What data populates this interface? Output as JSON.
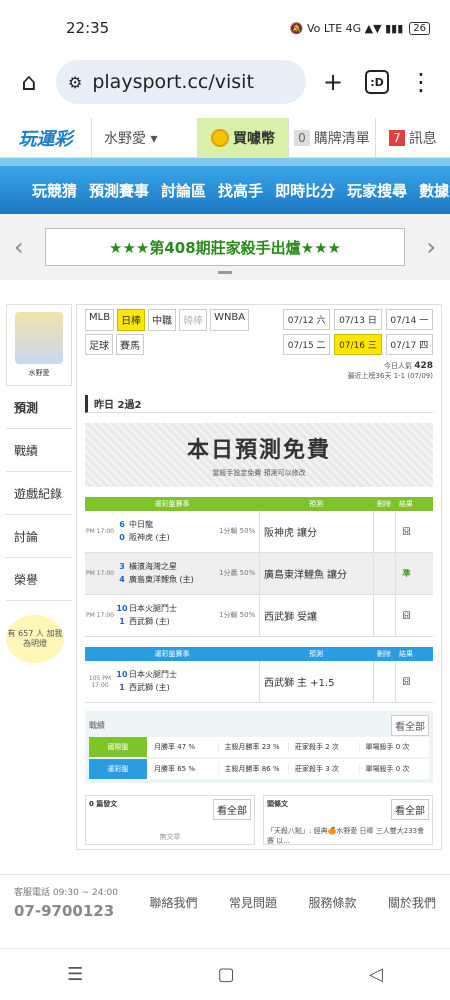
{
  "status": {
    "time": "22:35",
    "icons": "🔕 Vo LTE 4G ▲▼ ▮▮▮",
    "battery": "26"
  },
  "browser": {
    "url": "playsport.cc/visit",
    "tabs": ":D"
  },
  "topnav": {
    "logo": "玩運彩",
    "user": "水野愛 ▾",
    "buy": "買噱幣",
    "cart_count": "0",
    "cart": "購牌清單",
    "msg_count": "7",
    "msg": "訊息"
  },
  "mainnav": [
    "玩競猜",
    "預測賽事",
    "討論區",
    "找高手",
    "即時比分",
    "玩家搜尋",
    "數據"
  ],
  "banner": "★★★第408期莊家殺手出爐★★★",
  "sidebar": {
    "avatar_name": "水野愛",
    "items": [
      "預測",
      "戰績",
      "遊戲紀錄",
      "討論",
      "榮譽"
    ],
    "bulb": "有 657 人 加我為明燈"
  },
  "sports": [
    {
      "label": "MLB",
      "sel": false,
      "dis": false
    },
    {
      "label": "日棒",
      "sel": true,
      "dis": false
    },
    {
      "label": "中職",
      "sel": false,
      "dis": false
    },
    {
      "label": "韓棒",
      "sel": false,
      "dis": true
    },
    {
      "label": "WNBA",
      "sel": false,
      "dis": false
    },
    {
      "label": "足球",
      "sel": false,
      "dis": false
    },
    {
      "label": "賽馬",
      "sel": false,
      "dis": false
    }
  ],
  "dates": [
    {
      "label": "07/12 六",
      "sel": false
    },
    {
      "label": "07/13 日",
      "sel": false
    },
    {
      "label": "07/14 一",
      "sel": false
    },
    {
      "label": "07/15 二",
      "sel": false
    },
    {
      "label": "07/16 三",
      "sel": true
    },
    {
      "label": "07/17 四",
      "sel": false
    }
  ],
  "popularity": {
    "label": "今日人氣",
    "value": "428",
    "sub": "最近上榜36天 1-1 (07/09)"
  },
  "record": "昨日 2過2",
  "free": {
    "title": "本日預測免費",
    "sub": "當殺手設定免費 預測可以修改"
  },
  "table1": {
    "h1": "運彩盤賽事",
    "h2": "預測",
    "h3": "刪除",
    "h4": "結果",
    "games": [
      {
        "time": "PM 17:00",
        "s1": "6",
        "s2": "0",
        "t1": "中日龍",
        "t2": "阪神虎 (主)",
        "o1": "",
        "o2": "1分輸 50%",
        "pick": "阪神虎",
        "pick_note": "讓分",
        "res": "囧",
        "shade": false
      },
      {
        "time": "PM 17:00",
        "s1": "3",
        "s2": "4",
        "t1": "橫濱海灣之星",
        "t2": "廣島東洋鯉魚 (主)",
        "o1": "",
        "o2": "1分贏 50%",
        "pick": "廣島東洋鯉魚",
        "pick_note": "讓分",
        "res": "準",
        "shade": true
      },
      {
        "time": "PM 17:00",
        "s1": "10",
        "s2": "1",
        "t1": "日本火腿鬥士",
        "t2": "西武獅 (主)",
        "o1": "1分輸 50%",
        "o2": "",
        "pick": "西武獅",
        "pick_note": "受讓",
        "res": "囧",
        "shade": false
      }
    ]
  },
  "table2": {
    "h1": "運彩盤賽事",
    "h2": "預測",
    "h3": "刪除",
    "h4": "結果",
    "games": [
      {
        "time": "105 PM 17:00",
        "s1": "10",
        "s2": "1",
        "t1": "日本火腿鬥士",
        "t2": "西武獅 (主)",
        "pick": "西武獅",
        "pick_note": "主 +1.5",
        "res": "囧"
      }
    ]
  },
  "stats": {
    "title": "戰績",
    "more": "看全部",
    "rows": [
      {
        "tag": "國際盤",
        "color": "#7fc32b",
        "c1": "月勝率 47 %",
        "c2": "主殺月勝率 23 %",
        "c3": "莊家殺手 2 次",
        "c4": "單場殺手 0 次"
      },
      {
        "tag": "運彩盤",
        "color": "#2a9de0",
        "c1": "月勝率 65 %",
        "c2": "主殺月勝率 86 %",
        "c3": "莊家殺手 3 次",
        "c4": "單場殺手 0 次"
      }
    ]
  },
  "boxes": {
    "left_title": "0 篇發文",
    "left_more": "看全部",
    "left_empty": "無文章",
    "right_title": "頭條文",
    "right_more": "看全部",
    "right_body": "「天殺八點」: 經典🍊水野愛 日棒 三人雙大233會賽 以..."
  },
  "footer": {
    "phone_label": "客服電話 09:30 ~ 24:00",
    "phone": "07-9700123",
    "links": [
      "聯絡我們",
      "常見問題",
      "服務條款",
      "關於我們"
    ]
  },
  "navbar": [
    "☰",
    "▢",
    "◁"
  ]
}
